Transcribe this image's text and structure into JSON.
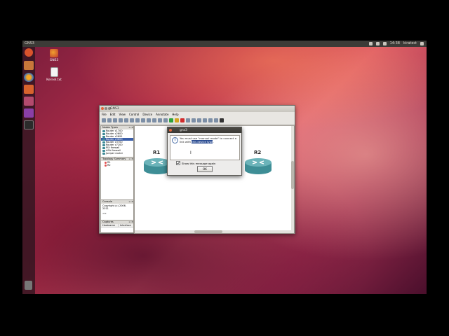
{
  "top_panel": {
    "app_title": "GNS3",
    "status_items": [
      "14:38",
      "kiratest"
    ]
  },
  "launcher": {
    "items": [
      "dash-icon",
      "files-icon",
      "firefox-icon",
      "ubuntu-software-icon",
      "settings-icon",
      "gns3-icon",
      "terminal-icon",
      "trash-icon"
    ]
  },
  "desktop": {
    "icons": [
      {
        "name": "gns3-desktop-icon",
        "label": "GNS3"
      },
      {
        "name": "text-file-icon",
        "label": "Kernel.txt"
      }
    ]
  },
  "main_window": {
    "title": "GNS3",
    "menu": [
      "File",
      "Edit",
      "View",
      "Control",
      "Device",
      "Annotate",
      "Help"
    ],
    "node_types": {
      "header": "Nodes Types",
      "items": [
        "Router c1700",
        "Router c2600",
        "Router c2691",
        "Router c3600",
        "Router c3700",
        "Router c7200",
        "PIX firewall",
        "ASA firewall",
        "Juniper router"
      ],
      "selected_index": 3
    },
    "topology_summary": {
      "header": "Topology Summary",
      "items": [
        "R1",
        "R2"
      ]
    },
    "console": {
      "header": "Console",
      "text": "Copyright (c) 2006-2011",
      "prompt": "=>"
    },
    "captures": {
      "header": "Captures",
      "columns": [
        "Hostname",
        "Interface"
      ]
    },
    "canvas": {
      "routers": [
        {
          "label": "R1"
        },
        {
          "label": "R2"
        }
      ]
    }
  },
  "dialog": {
    "title": "gns3",
    "message_before": "You must use \"manual mode\" to connect a link with ",
    "message_highlight": "this device type",
    "message_after": ".",
    "checkbox_label": "Show this message again",
    "checkbox_checked": true,
    "ok_label": "OK"
  }
}
